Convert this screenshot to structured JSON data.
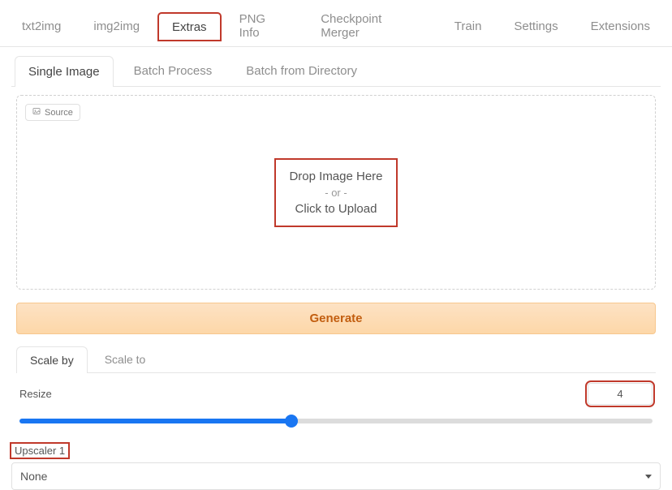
{
  "topTabs": [
    {
      "label": "txt2img"
    },
    {
      "label": "img2img"
    },
    {
      "label": "Extras"
    },
    {
      "label": "PNG Info"
    },
    {
      "label": "Checkpoint Merger"
    },
    {
      "label": "Train"
    },
    {
      "label": "Settings"
    },
    {
      "label": "Extensions"
    }
  ],
  "subTabs": [
    {
      "label": "Single Image"
    },
    {
      "label": "Batch Process"
    },
    {
      "label": "Batch from Directory"
    }
  ],
  "source_badge": "Source",
  "dropzone": {
    "line1": "Drop Image Here",
    "or": "- or -",
    "line2": "Click to Upload"
  },
  "generate_label": "Generate",
  "scaleTabs": [
    {
      "label": "Scale by"
    },
    {
      "label": "Scale to"
    }
  ],
  "resize": {
    "label": "Resize",
    "value": "4",
    "min": 1,
    "max": 8
  },
  "upscaler": {
    "label": "Upscaler 1",
    "selected": "None"
  }
}
